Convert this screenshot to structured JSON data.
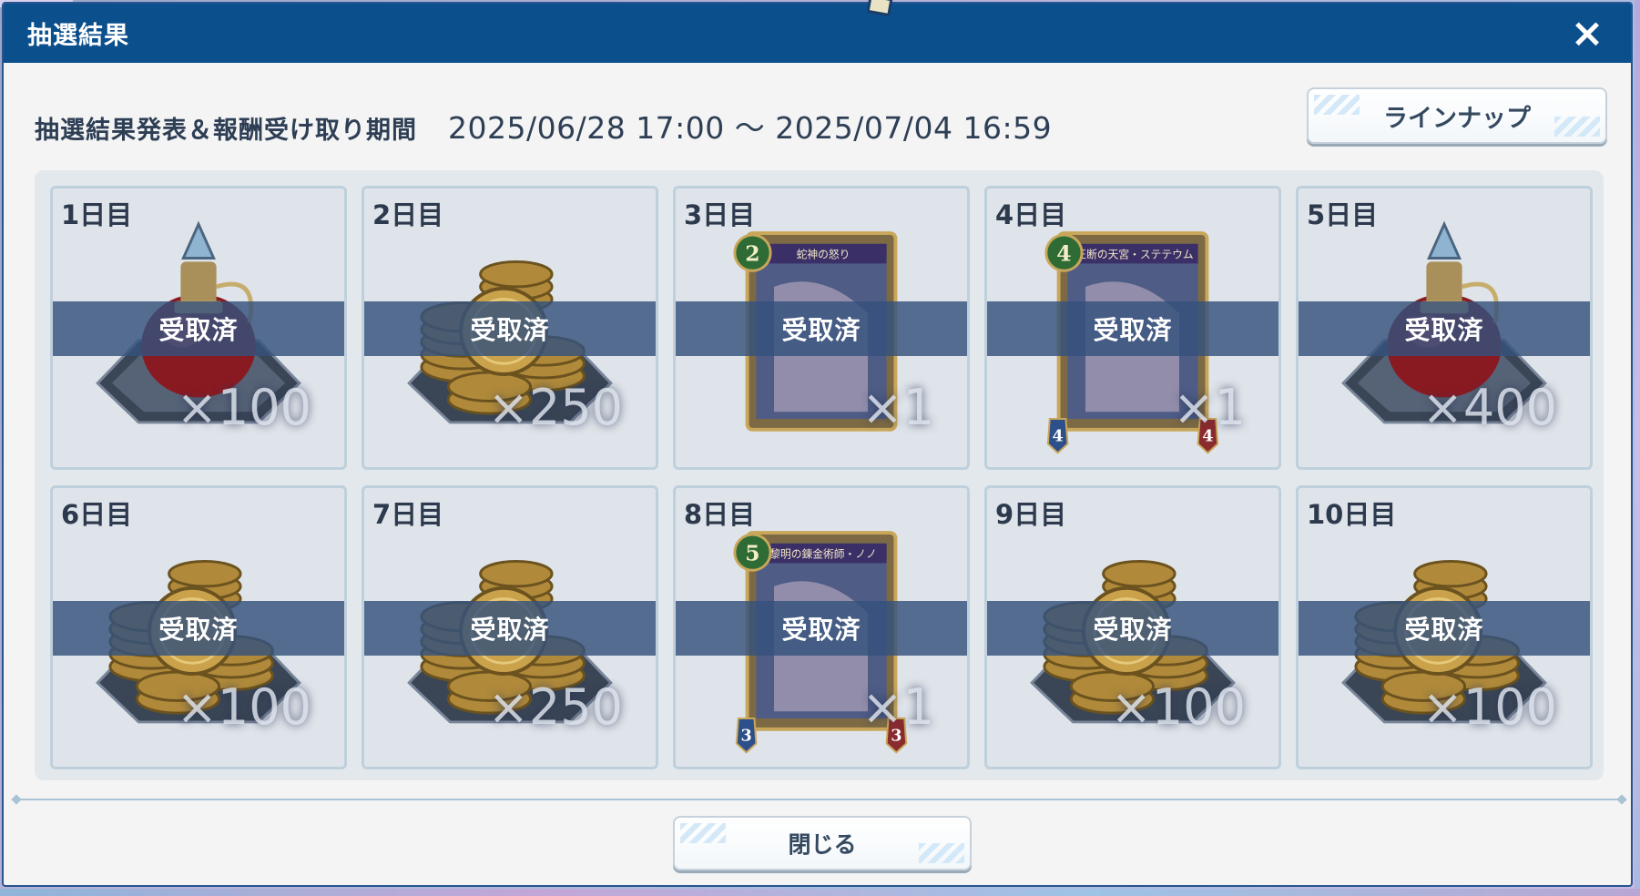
{
  "dialog": {
    "title": "抽選結果",
    "close_icon": "×",
    "period_label": "抽選結果発表＆報酬受け取り期間",
    "period_range": "2025/06/28 17:00 ～ 2025/07/04 16:59",
    "lineup_button": "ラインナップ",
    "close_button": "閉じる"
  },
  "rewards": [
    {
      "day": "1日目",
      "status": "受取済",
      "qty": "×100",
      "icon": "potion-icon"
    },
    {
      "day": "2日目",
      "status": "受取済",
      "qty": "×250",
      "icon": "coins-icon"
    },
    {
      "day": "3日目",
      "status": "受取済",
      "qty": "×1",
      "icon": "card-icon",
      "card_title": "蛇神の怒り",
      "cost": "2"
    },
    {
      "day": "4日目",
      "status": "受取済",
      "qty": "×1",
      "icon": "card-icon",
      "card_title": "王断の天宮・ステテウム",
      "cost": "4",
      "attack": "4",
      "defense": "4"
    },
    {
      "day": "5日目",
      "status": "受取済",
      "qty": "×400",
      "icon": "potion-icon"
    },
    {
      "day": "6日目",
      "status": "受取済",
      "qty": "×100",
      "icon": "coins-icon"
    },
    {
      "day": "7日目",
      "status": "受取済",
      "qty": "×250",
      "icon": "coins-icon"
    },
    {
      "day": "8日目",
      "status": "受取済",
      "qty": "×1",
      "icon": "card-icon",
      "card_title": "黎明の錬金術師・ノノ",
      "cost": "5",
      "attack": "3",
      "defense": "3"
    },
    {
      "day": "9日目",
      "status": "受取済",
      "qty": "×100",
      "icon": "coins-icon"
    },
    {
      "day": "10日目",
      "status": "受取済",
      "qty": "×100",
      "icon": "coins-icon"
    }
  ],
  "colors": {
    "titlebar": "#0b4f8c",
    "banner": "#34527c",
    "panel": "#e3e8ec"
  }
}
